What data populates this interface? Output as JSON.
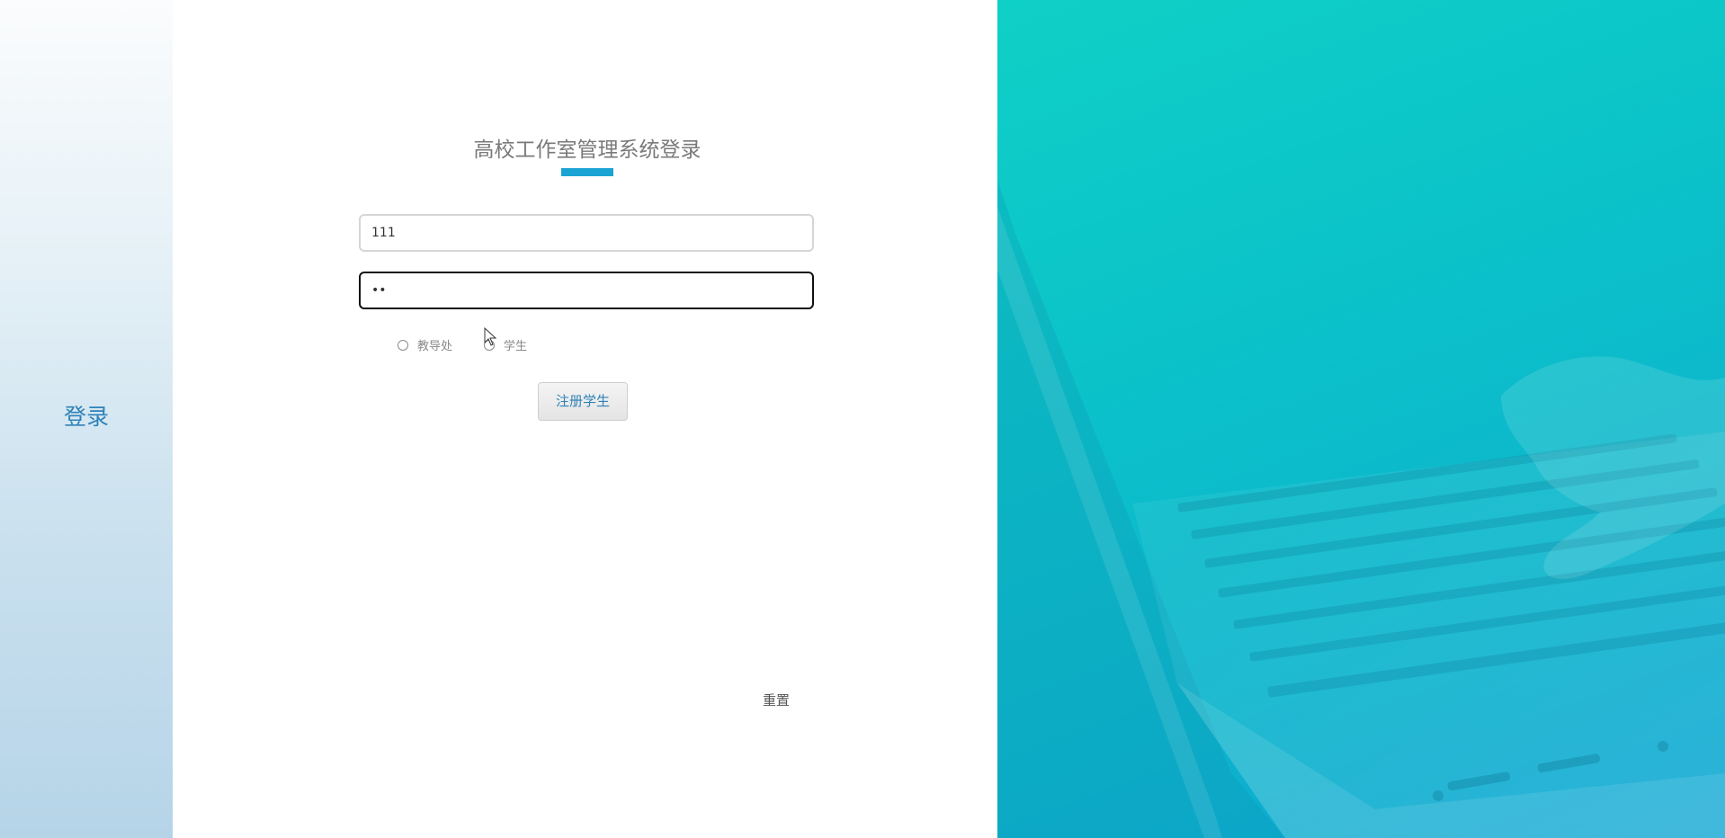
{
  "sidebar": {
    "login_label": "登录"
  },
  "form": {
    "title": "高校工作室管理系统登录",
    "username_value": "111",
    "password_value": "••",
    "roles": [
      {
        "label": "教导处",
        "selected": false
      },
      {
        "label": "学生",
        "selected": false
      }
    ],
    "register_label": "注册学生",
    "reset_label": "重置"
  },
  "colors": {
    "accent": "#1aa3d3",
    "link": "#2f82b8",
    "hero_start": "#0fd0c6",
    "hero_end": "#0fa6d4"
  },
  "icons": {
    "cursor": "mouse-pointer-icon"
  }
}
